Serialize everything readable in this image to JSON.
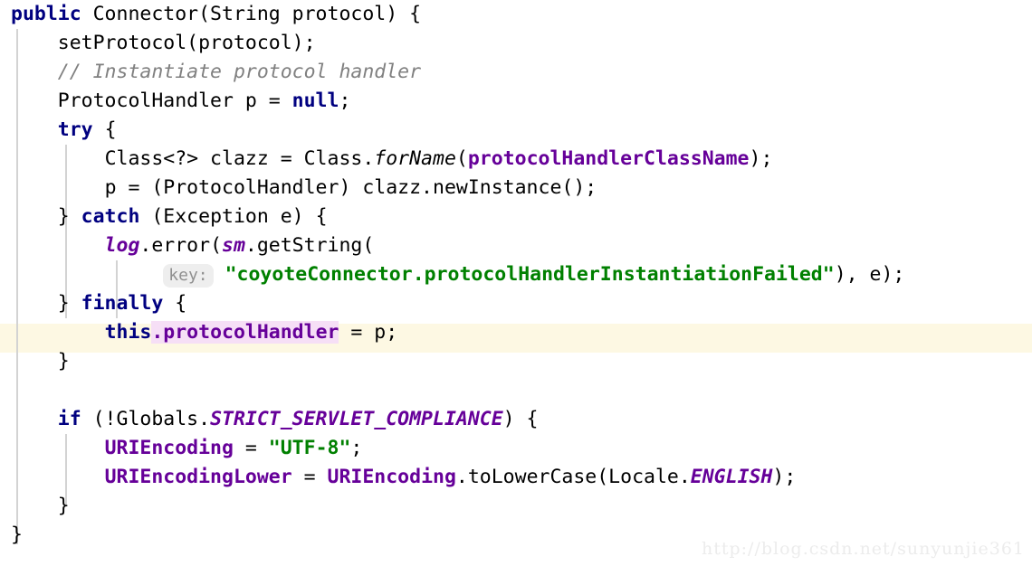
{
  "editor": {
    "background_color": "#ffffff",
    "current_line_highlight_color": "#fdf8e3",
    "occurrence_highlight_color": "#f6dff6",
    "guide_color": "#d3d3d3",
    "colors": {
      "keyword": "#000080",
      "string": "#008000",
      "comment": "#808080",
      "field": "#660099",
      "plain": "#000000",
      "param_hint_text": "#909090",
      "param_hint_background": "#eeeeee"
    },
    "param_hint_label": "key:",
    "watermark": "http://blog.csdn.net/sunyunjie361",
    "lines": {
      "l1_kw_public": "public",
      "l1_rest": " Connector(String protocol) {",
      "l2": "    setProtocol(protocol);",
      "l3_comment": "// Instantiate protocol handler",
      "l4_a": "ProtocolHandler p = ",
      "l4_kw_null": "null",
      "l4_b": ";",
      "l5_kw_try": "try",
      "l5_rest": " {",
      "l6_a": "Class<?> clazz = Class.",
      "l6_static_forname": "forName",
      "l6_b": "(",
      "l6_field": "protocolHandlerClassName",
      "l6_c": ");",
      "l7": "p = (ProtocolHandler) clazz.newInstance();",
      "l8_brace": "} ",
      "l8_kw_catch": "catch",
      "l8_rest": " (Exception e) {",
      "l9_static_log": "log",
      "l9_a": ".error(",
      "l9_static_sm": "sm",
      "l9_b": ".getString(",
      "l10_string": "\"coyoteConnector.protocolHandlerInstantiationFailed\"",
      "l10_tail": "), e);",
      "l11_brace": "} ",
      "l11_kw_finally": "finally",
      "l11_rest": " {",
      "l12_kw_this": "this",
      "l12_dot": ".",
      "l12_field": "protocolHandler",
      "l12_tail": " = p;",
      "l13": "}",
      "l14": "",
      "l15_kw_if": "if",
      "l15_a": " (!Globals.",
      "l15_const": "STRICT_SERVLET_COMPLIANCE",
      "l15_b": ") {",
      "l16_field": "URIEncoding",
      "l16_eq": " = ",
      "l16_string": "\"UTF-8\"",
      "l16_tail": ";",
      "l17_field_a": "URIEncodingLower",
      "l17_eq": " = ",
      "l17_field_b": "URIEncoding",
      "l17_mid": ".toLowerCase(Locale.",
      "l17_const": "ENGLISH",
      "l17_tail": ");",
      "l18": "}",
      "l19": "}"
    }
  }
}
